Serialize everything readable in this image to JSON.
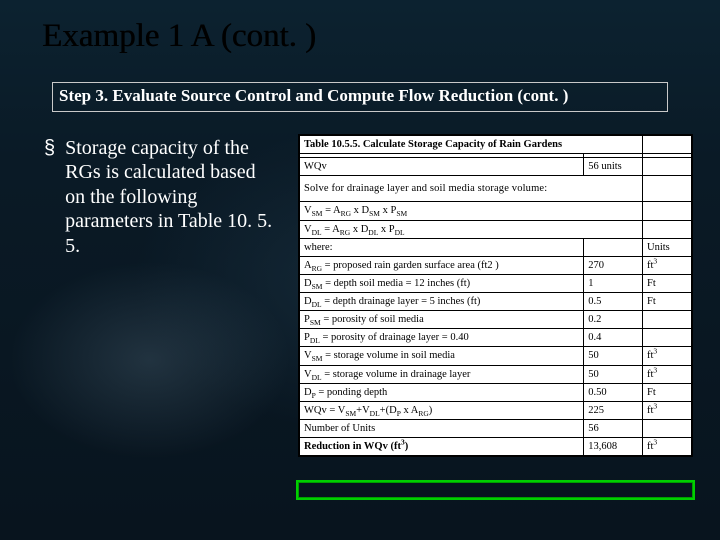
{
  "title": "Example 1 A (cont. )",
  "subtitle": "Step 3. Evaluate Source Control and Compute Flow Reduction (cont. )",
  "bullet": {
    "marker": "§",
    "text": "Storage capacity of the RGs is calculated based on the following parameters in Table 10. 5. 5."
  },
  "table": {
    "caption": "Table 10.5.5. Calculate Storage Capacity of Rain Gardens",
    "wqv_label": "WQv",
    "wqv_value": "56 units",
    "solve_text": "Solve for drainage layer and soil media storage volume:",
    "eq_vsm": "V_SM = A_RG × D_SM × P_SM",
    "eq_vdl": "V_DL = A_RG × D_DL × P_DL",
    "where_label": "where:",
    "units_label": "Units",
    "rows": [
      {
        "desc": "A_RG = proposed rain garden surface area (ft2 )",
        "val": "270",
        "unit": "ft³"
      },
      {
        "desc": "D_SM = depth soil media = 12 inches (ft)",
        "val": "1",
        "unit": "Ft"
      },
      {
        "desc": "D_DL = depth drainage layer = 5 inches (ft)",
        "val": "0.5",
        "unit": "Ft"
      },
      {
        "desc": "P_SM = porosity of soil media",
        "val": "0.2",
        "unit": ""
      },
      {
        "desc": "P_DL = porosity of drainage layer = 0.40",
        "val": "0.4",
        "unit": ""
      },
      {
        "desc": "V_SM = storage volume in soil media",
        "val": "50",
        "unit": "ft³"
      },
      {
        "desc": "V_DL = storage volume in drainage layer",
        "val": "50",
        "unit": "ft³"
      },
      {
        "desc": "D_P = ponding depth",
        "val": "0.50",
        "unit": "Ft"
      },
      {
        "desc": "WQv = V_SM+V_DL+(D_P × A_RG)",
        "val": "225",
        "unit": "ft³"
      },
      {
        "desc": "Number of Units",
        "val": "56",
        "unit": ""
      }
    ],
    "hl": {
      "desc": "Reduction in WQv (ft³)",
      "val": "13,608",
      "unit": "ft³"
    }
  }
}
